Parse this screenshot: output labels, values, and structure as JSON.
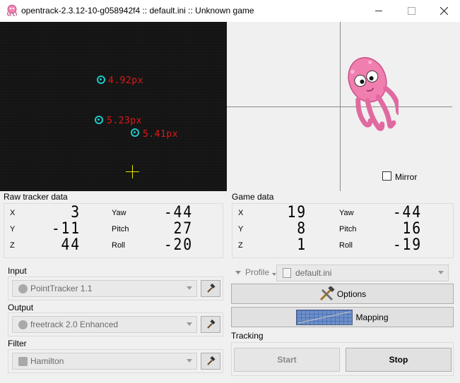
{
  "window": {
    "title": "opentrack-2.3.12-10-g058942f4 :: default.ini :: Unknown game",
    "minimize": "—",
    "maximize": "☐",
    "close": "✕"
  },
  "video": {
    "points": [
      {
        "label": "4.92px"
      },
      {
        "label": "5.23px"
      },
      {
        "label": "5.41px"
      }
    ]
  },
  "pose": {
    "mirror_label": "Mirror",
    "mirror_checked": false
  },
  "raw_tracker": {
    "title": "Raw tracker data",
    "rows": [
      {
        "axis": "X",
        "value": "3",
        "rot": "Yaw",
        "rot_value": "-44"
      },
      {
        "axis": "Y",
        "value": "-11",
        "rot": "Pitch",
        "rot_value": "27"
      },
      {
        "axis": "Z",
        "value": "44",
        "rot": "Roll",
        "rot_value": "-20"
      }
    ]
  },
  "game_data": {
    "title": "Game data",
    "rows": [
      {
        "axis": "X",
        "value": "19",
        "rot": "Yaw",
        "rot_value": "-44"
      },
      {
        "axis": "Y",
        "value": "8",
        "rot": "Pitch",
        "rot_value": "16"
      },
      {
        "axis": "Z",
        "value": "1",
        "rot": "Roll",
        "rot_value": "-19"
      }
    ]
  },
  "input": {
    "title": "Input",
    "value": "PointTracker 1.1",
    "icon": "hammer-icon"
  },
  "output": {
    "title": "Output",
    "value": "freetrack 2.0 Enhanced",
    "icon": "hammer-icon"
  },
  "filter": {
    "title": "Filter",
    "value": "Hamilton",
    "icon": "hammer-icon"
  },
  "profile": {
    "label": "Profile",
    "value": "default.ini"
  },
  "options_label": "Options",
  "mapping_label": "Mapping",
  "tracking": {
    "title": "Tracking",
    "start_label": "Start",
    "stop_label": "Stop"
  },
  "colors": {
    "point_ring": "#1ec8c8",
    "point_label": "#e01818",
    "crosshair": "#e6e600",
    "video_bg": "#141414",
    "octopus": "#f07fb0"
  }
}
